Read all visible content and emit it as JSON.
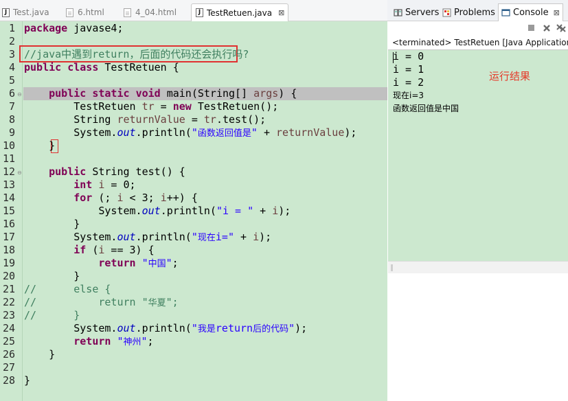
{
  "editor_tabs": [
    {
      "label": "Test.java",
      "icon": "java-file-icon",
      "active": false
    },
    {
      "label": "6.html",
      "icon": "html-file-icon",
      "active": false
    },
    {
      "label": "4_04.html",
      "icon": "html-file-icon",
      "active": false
    },
    {
      "label": "TestRetuen.java",
      "icon": "java-file-icon",
      "active": true,
      "close": "⊠"
    }
  ],
  "code": {
    "line_numbers": [
      "1",
      "2",
      "3",
      "4",
      "5",
      "6",
      "7",
      "8",
      "9",
      "10",
      "11",
      "12",
      "13",
      "14",
      "15",
      "16",
      "17",
      "18",
      "19",
      "20",
      "21",
      "22",
      "23",
      "24",
      "25",
      "26",
      "27",
      "28"
    ],
    "comment_highlight": "//java中遇到return，后面的代码还会执行吗?",
    "colors": {
      "keyword": "#7f0055",
      "string": "#2a00ff",
      "comment": "#3f7f5f",
      "background": "#cce8cf",
      "annotation": "#e03030"
    }
  },
  "view_tabs": [
    {
      "label": "Servers",
      "icon": "servers-icon"
    },
    {
      "label": "Problems",
      "icon": "problems-icon"
    },
    {
      "label": "Console",
      "icon": "console-icon",
      "active": true,
      "close": "⊠"
    }
  ],
  "console": {
    "label": "<terminated> TestRetuen [Java Application]",
    "lines": [
      "i = 0",
      "i = 1",
      "i = 2",
      "现在i=3",
      "函数返回值是中国"
    ],
    "annotation": "运行结果"
  }
}
